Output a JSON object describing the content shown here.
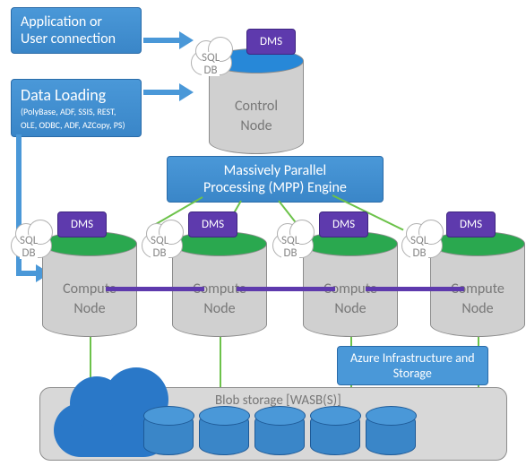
{
  "boxes": {
    "app_conn_l1": "Application or",
    "app_conn_l2": "User connection",
    "data_loading_title": "Data Loading",
    "data_loading_paren_l1": "(PolyBase, ADF, SSIS, REST,",
    "data_loading_paren_l2": "OLE, ODBC, ADF, AZCopy, PS)",
    "mpp_l1": "Massively Parallel",
    "mpp_l2": "Processing (MPP) Engine",
    "azure_l1": "Azure Infrastructure and",
    "azure_l2": "Storage"
  },
  "labels": {
    "sql": "SQL",
    "db": "DB",
    "dms": "DMS"
  },
  "nodes": {
    "control_l1": "Control",
    "control_l2": "Node",
    "compute_l1": "Compute",
    "compute_l2": "Node"
  },
  "blob": {
    "label": "Blob storage [WASB(S)]"
  }
}
